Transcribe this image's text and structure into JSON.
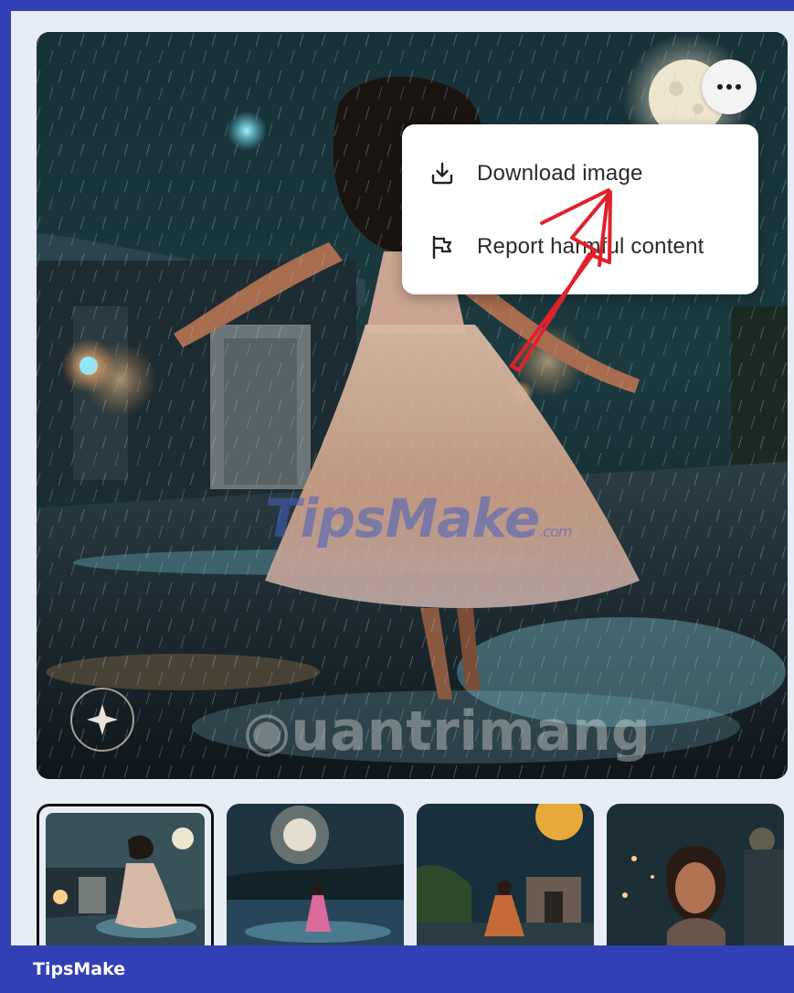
{
  "menu": {
    "download_label": "Download image",
    "report_label": "Report harmful content"
  },
  "icons": {
    "more": "more-horizontal-icon",
    "download": "download-icon",
    "report": "flag-icon"
  },
  "watermarks": {
    "tipsmake": "TipsMake",
    "tipsmake_suffix": ".com",
    "quantrimang": "uantrimang"
  },
  "footer": {
    "label": "TipsMake"
  },
  "colors": {
    "footer_bg": "#3340b5",
    "page_bg": "#e7edf6",
    "annotation_arrow": "#e0212b"
  },
  "thumbnails": {
    "count": 4,
    "selected_index": 0
  }
}
